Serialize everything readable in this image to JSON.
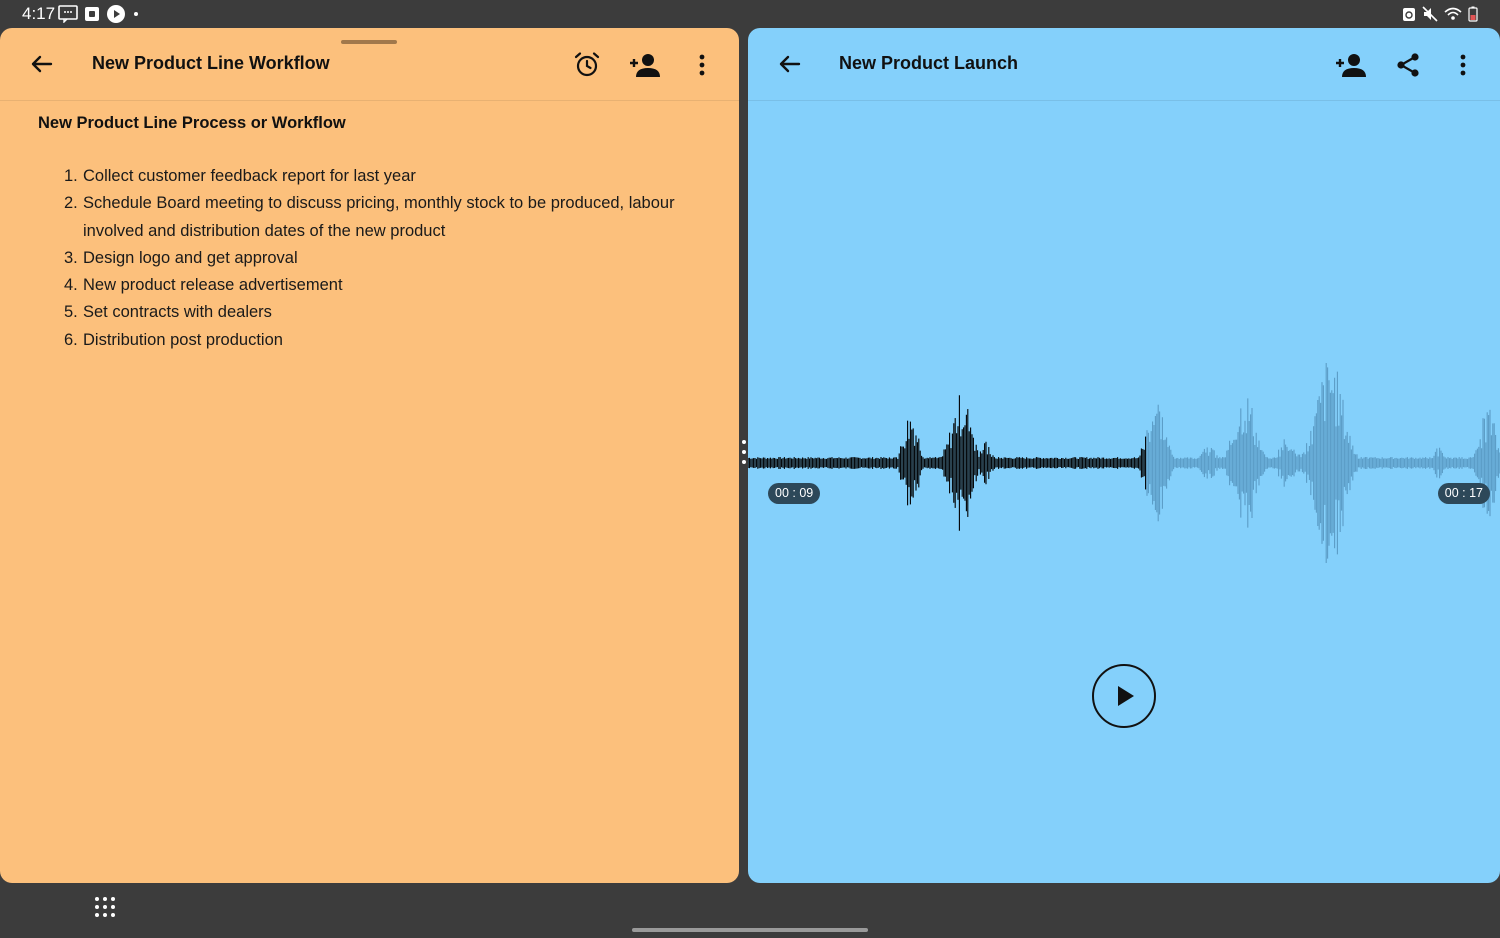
{
  "status_bar": {
    "time": "4:17",
    "left_icons": [
      "screenshot-icon",
      "app-icon",
      "play-notification-icon",
      "dot-icon"
    ],
    "right_icons": [
      "sync-icon",
      "mute-icon",
      "wifi-icon",
      "battery-icon"
    ]
  },
  "left_panel": {
    "background": "#fcc07c",
    "title": "New Product Line Workflow",
    "actions": [
      "alarm-icon",
      "add-person-icon",
      "more-vert-icon"
    ],
    "note": {
      "heading": "New Product Line Process or Workflow",
      "items": [
        {
          "num": "1.",
          "text": "Collect customer feedback report for last year"
        },
        {
          "num": "2.",
          "text": "Schedule Board meeting to discuss pricing, monthly stock to be produced, labour involved and distribution dates of the new product"
        },
        {
          "num": "3.",
          "text": "Design logo and get approval"
        },
        {
          "num": "4.",
          "text": "New product release advertisement"
        },
        {
          "num": "5.",
          "text": "Set contracts with dealers"
        },
        {
          "num": "6.",
          "text": "Distribution post production"
        }
      ]
    }
  },
  "right_panel": {
    "background": "#84d0fb",
    "title": "New Product Launch",
    "actions": [
      "add-person-icon",
      "share-icon",
      "more-vert-icon"
    ],
    "audio": {
      "current_time": "00 : 09",
      "total_time": "00 : 17",
      "played_color": "#000000",
      "unplayed_color": "#5b9cc6",
      "playback_fraction": 0.53
    }
  },
  "bottom_bar": {
    "apps_icon": "apps-grid-icon"
  }
}
